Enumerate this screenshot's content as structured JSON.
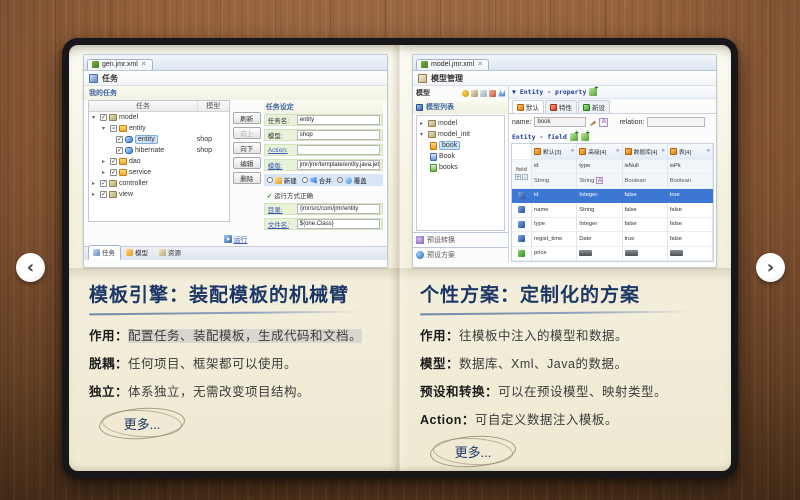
{
  "nav": {
    "prev": "‹",
    "next": "›"
  },
  "left": {
    "tab": "gen.jmr.xml",
    "close": "✕",
    "view": "任务",
    "tasks_title": "我的任务",
    "cols": {
      "task": "任务",
      "model": "模型"
    },
    "tree": [
      {
        "name": "model",
        "model": ""
      },
      {
        "name": "entity",
        "model": ""
      },
      {
        "name": "entity",
        "model": "shop"
      },
      {
        "name": "hibernate",
        "model": "shop"
      },
      {
        "name": "dao",
        "model": ""
      },
      {
        "name": "service",
        "model": ""
      },
      {
        "name": "controller",
        "model": ""
      },
      {
        "name": "view",
        "model": ""
      }
    ],
    "buttons": [
      "刷新",
      "向上",
      "向下",
      "编辑",
      "删除"
    ],
    "settings": "任务设定",
    "f_task": {
      "label": "任务名:",
      "value": "entity"
    },
    "f_model": {
      "label": "模型:",
      "value": "shop"
    },
    "f_action": {
      "label": "Action:",
      "value": ""
    },
    "f_tpl": {
      "label": "模版:",
      "value": "jmr/jmr/template/entity.java.jet"
    },
    "radios": [
      "新建",
      "合并",
      "覆盖"
    ],
    "radio_note": "运行方式正确",
    "f_dir": {
      "label": "目录:",
      "value": "/jmr/src/com/jmr/entity"
    },
    "f_file": {
      "label": "文件名:",
      "value": "${one.Class}"
    },
    "run": "运行",
    "tabs": [
      "任务",
      "模型",
      "资源"
    ]
  },
  "right": {
    "tab": "model.jmr.xml",
    "close": "✕",
    "view": "模型管理",
    "panel": "模型",
    "list": "模型列表",
    "tree": [
      "model",
      "model_init",
      "book",
      "Book",
      "books"
    ],
    "side": [
      "预设转换",
      "预设方案"
    ],
    "prop_header": "▼ Entity - property",
    "prop_tabs": [
      "默认",
      "特性",
      "新设"
    ],
    "name_label": "name:",
    "name_value": "book",
    "rel_label": "relation:",
    "field_header": "Entity - field",
    "groups": [
      "默认[3]",
      "高级[4]",
      "数据库[4]",
      "表[4]"
    ],
    "group_arrow": "»",
    "field_col": "field",
    "sub1": [
      "id",
      "type",
      "isNull",
      "isPk"
    ],
    "sub2": [
      "String",
      "String",
      "Boolean",
      "Boolean"
    ],
    "rows": [
      [
        "id",
        "Integer",
        "false",
        "true"
      ],
      [
        "name",
        "String",
        "false",
        "false"
      ],
      [
        "type",
        "Integer",
        "false",
        "false"
      ],
      [
        "regist_time",
        "Date",
        "true",
        "false"
      ],
      [
        "price",
        "",
        "",
        ""
      ]
    ]
  },
  "captions": {
    "left": {
      "title": "模板引擎：装配模板的机械臂",
      "l1": {
        "label": "作用：",
        "text": "配置任务、装配模板，生成代码和文档。"
      },
      "l2": {
        "label": "脱耦：",
        "text": "任何项目、框架都可以使用。"
      },
      "l3": {
        "label": "独立：",
        "text": "体系独立，无需改变项目结构。"
      },
      "more": "更多..."
    },
    "right": {
      "title": "个性方案：定制化的方案",
      "l1": {
        "label": "作用：",
        "text": "往模板中注入的模型和数据。"
      },
      "l2": {
        "label": "模型：",
        "text": "数据库、Xml、Java的数据。"
      },
      "l3": {
        "label": "预设和转换：",
        "text": "可以在预设模型、映射类型。"
      },
      "l4": {
        "label": "Action：",
        "text": "可自定义数据注入模板。"
      },
      "more": "更多..."
    }
  },
  "colors": {
    "accent": "#1c3765",
    "selection": "#3b77d3",
    "wood": "#7d5231"
  }
}
